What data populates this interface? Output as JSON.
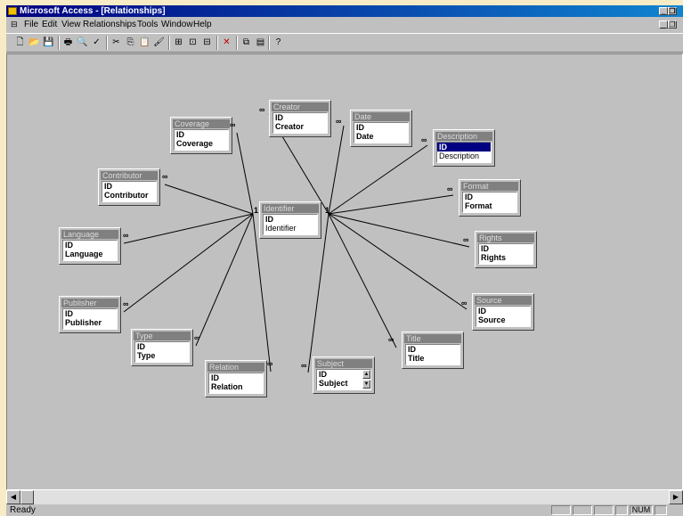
{
  "window": {
    "title": "Microsoft Access - [Relationships]"
  },
  "menu": [
    "File",
    "Edit",
    "View",
    "Relationships",
    "Tools",
    "Window",
    "Help"
  ],
  "toolbar_icons": [
    "new-icon",
    "open-icon",
    "save-icon",
    "print-icon",
    "print-preview-icon",
    "spelling-icon",
    "cut-icon",
    "copy-icon",
    "paste-icon",
    "format-painter-icon",
    "show-table-icon",
    "show-direct-icon",
    "show-all-icon",
    "delete-icon",
    "database-window-icon",
    "new-object-icon",
    "help-icon"
  ],
  "tables": [
    {
      "name": "Identifier",
      "fields": [
        "ID",
        "Identifier"
      ]
    },
    {
      "name": "Creator",
      "fields": [
        "ID",
        "Creator"
      ]
    },
    {
      "name": "Date",
      "fields": [
        "ID",
        "Date"
      ]
    },
    {
      "name": "Description",
      "fields": [
        "ID",
        "Description"
      ]
    },
    {
      "name": "Format",
      "fields": [
        "ID",
        "Format"
      ]
    },
    {
      "name": "Rights",
      "fields": [
        "ID",
        "Rights"
      ]
    },
    {
      "name": "Source",
      "fields": [
        "ID",
        "Source"
      ]
    },
    {
      "name": "Title",
      "fields": [
        "ID",
        "Title"
      ]
    },
    {
      "name": "Subject",
      "fields": [
        "ID",
        "Subject"
      ]
    },
    {
      "name": "Relation",
      "fields": [
        "ID",
        "Relation"
      ]
    },
    {
      "name": "Type",
      "fields": [
        "ID",
        "Type"
      ]
    },
    {
      "name": "Publisher",
      "fields": [
        "ID",
        "Publisher"
      ]
    },
    {
      "name": "Language",
      "fields": [
        "ID",
        "Language"
      ]
    },
    {
      "name": "Contributor",
      "fields": [
        "ID",
        "Contributor"
      ]
    },
    {
      "name": "Coverage",
      "fields": [
        "ID",
        "Coverage"
      ]
    }
  ],
  "relationship_labels": {
    "one": "1",
    "many": "∞"
  },
  "status": {
    "text": "Ready",
    "num": "NUM"
  }
}
